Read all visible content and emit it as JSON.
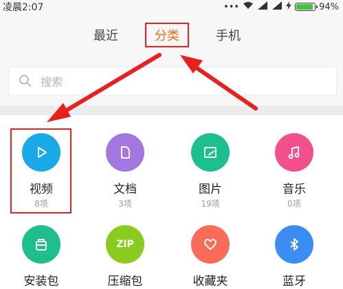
{
  "status_bar": {
    "time": "凌晨2:07",
    "dots": "•••",
    "battery": "94%",
    "battery_level": 0.94
  },
  "tabs": [
    {
      "label": "最近",
      "active": false
    },
    {
      "label": "分类",
      "active": true
    },
    {
      "label": "手机",
      "active": false
    }
  ],
  "search": {
    "placeholder": "搜索"
  },
  "categories": [
    {
      "label": "视频",
      "count": "8项",
      "icon": "play-icon",
      "color": "#1aa9e8"
    },
    {
      "label": "文档",
      "count": "3项",
      "icon": "document-icon",
      "color": "#a476e0"
    },
    {
      "label": "图片",
      "count": "19项",
      "icon": "image-icon",
      "color": "#1dbf8e"
    },
    {
      "label": "音乐",
      "count": "0项",
      "icon": "music-icon",
      "color": "#f2508d"
    },
    {
      "label": "安装包",
      "count": "",
      "icon": "package-icon",
      "color": "#1ebf8c"
    },
    {
      "label": "压缩包",
      "count": "",
      "icon": "zip-icon",
      "color": "#8bcb1e",
      "icon_text": "ZIP"
    },
    {
      "label": "收藏夹",
      "count": "",
      "icon": "heart-icon",
      "color": "#fa6b58"
    },
    {
      "label": "蓝牙",
      "count": "",
      "icon": "bluetooth-icon",
      "color": "#3a8df2"
    }
  ],
  "colors": {
    "active_tab": "#f56a16",
    "annotation": "#e8201e"
  }
}
